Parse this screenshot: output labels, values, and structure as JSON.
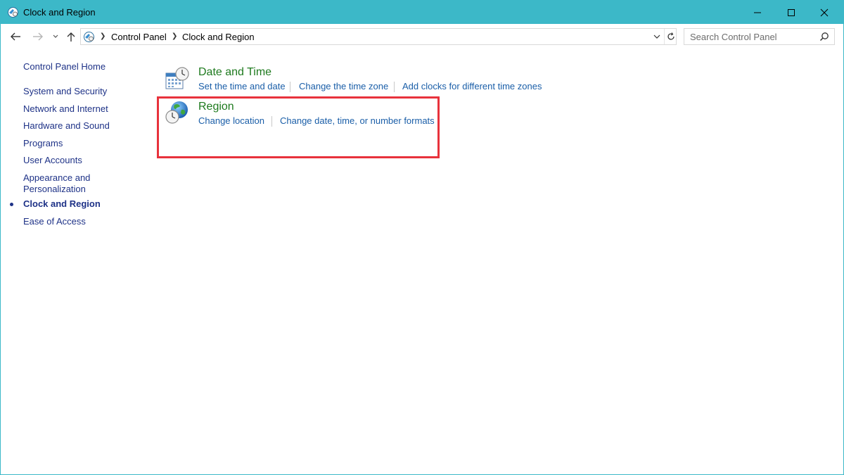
{
  "window": {
    "title": "Clock and Region",
    "controls": {
      "minimize": "minimize",
      "maximize": "maximize",
      "close": "close"
    }
  },
  "address": {
    "breadcrumbs": [
      "Control Panel",
      "Clock and Region"
    ]
  },
  "search": {
    "placeholder": "Search Control Panel"
  },
  "sidebar": {
    "home": "Control Panel Home",
    "items": [
      {
        "label": "System and Security"
      },
      {
        "label": "Network and Internet"
      },
      {
        "label": "Hardware and Sound"
      },
      {
        "label": "Programs"
      },
      {
        "label": "User Accounts"
      },
      {
        "label": "Appearance and",
        "label2": "Personalization"
      },
      {
        "label": "Clock and Region",
        "current": true
      },
      {
        "label": "Ease of Access"
      }
    ]
  },
  "main": {
    "categories": [
      {
        "title": "Date and Time",
        "icon": "calendar-clock-icon",
        "tasks": [
          "Set the time and date",
          "Change the time zone",
          "Add clocks for different time zones"
        ]
      },
      {
        "title": "Region",
        "icon": "globe-clock-icon",
        "tasks": [
          "Change location",
          "Change date, time, or number formats"
        ]
      }
    ]
  },
  "colors": {
    "titlebar": "#3cb8c8",
    "category_title": "#1e7a1e",
    "task_link": "#1a5ea8",
    "sidebar_link": "#1e3287",
    "highlight": "#e8323c"
  }
}
